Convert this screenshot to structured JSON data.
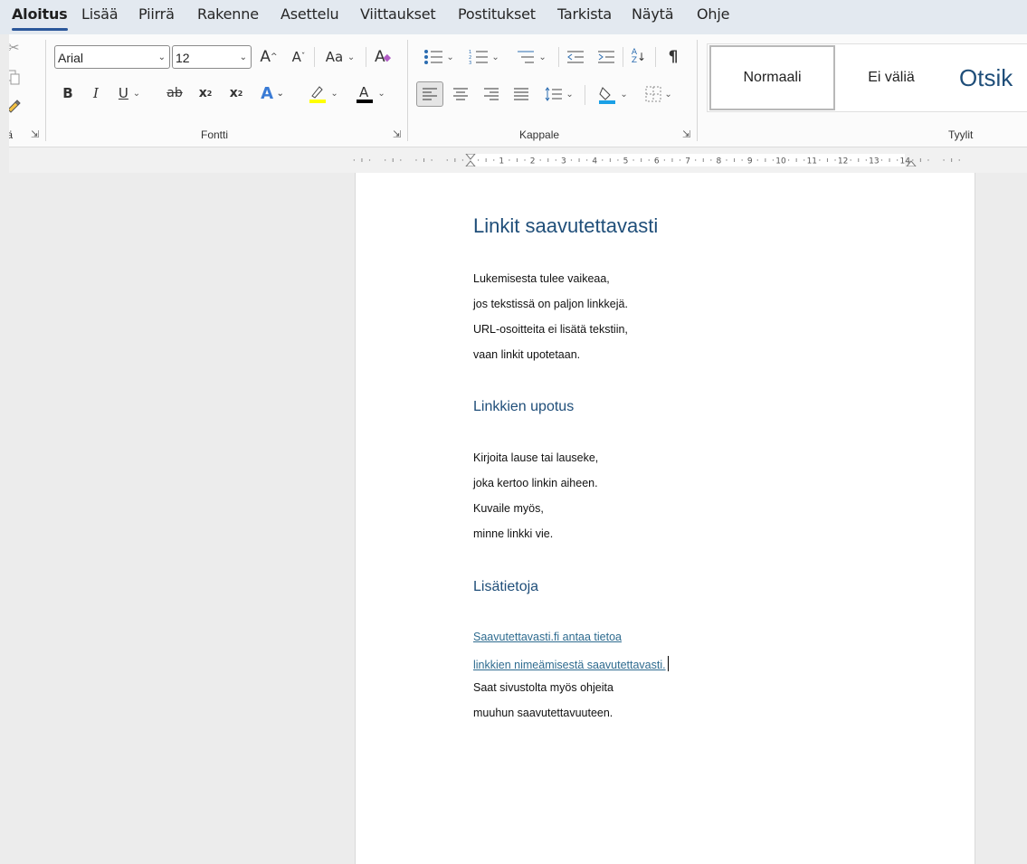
{
  "tabs": [
    "Aloitus",
    "Lisää",
    "Piirrä",
    "Rakenne",
    "Asettelu",
    "Viittaukset",
    "Postitukset",
    "Tarkista",
    "Näytä",
    "Ohje"
  ],
  "ribbon": {
    "clipboard_label_partial": "tä",
    "font_name": "Arial",
    "font_size": "12",
    "groups": {
      "font": "Fontti",
      "paragraph": "Kappale",
      "styles": "Tyylit"
    },
    "styles": [
      "Normaali",
      "Ei väliä",
      "Otsik"
    ],
    "change_case_label": "Aa",
    "icons": [
      "cut-icon",
      "copy-icon",
      "format-painter-icon",
      "grow-font-icon",
      "shrink-font-icon",
      "clear-formatting-icon",
      "bold-icon",
      "italic-icon",
      "underline-icon",
      "strikethrough-icon",
      "subscript-icon",
      "superscript-icon",
      "text-effects-icon",
      "highlight-icon",
      "font-color-icon",
      "bullets-icon",
      "numbering-icon",
      "multilevel-list-icon",
      "decrease-indent-icon",
      "increase-indent-icon",
      "sort-icon",
      "show-marks-icon",
      "align-left-icon",
      "center-icon",
      "align-right-icon",
      "justify-icon",
      "line-spacing-icon",
      "shading-icon",
      "borders-icon"
    ],
    "highlight_color": "#ffff00",
    "font_color": "#000000",
    "shading_color": "#1aa0e6"
  },
  "ruler": {
    "numbers": [
      "1",
      "2",
      "3",
      "4",
      "5",
      "6",
      "7",
      "8",
      "9",
      "10",
      "11",
      "12",
      "13",
      "14"
    ]
  },
  "document": {
    "title": "Linkit saavutettavasti",
    "para1": [
      "Lukemisesta tulee vaikeaa,",
      "jos tekstissä on paljon linkkejä.",
      "URL-osoitteita ei lisätä tekstiin,",
      "vaan linkit upotetaan."
    ],
    "heading2": "Linkkien upotus",
    "para2": [
      "Kirjoita lause tai lauseke,",
      "joka kertoo linkin aiheen.",
      "Kuvaile myös,",
      "minne linkki vie."
    ],
    "heading3": "Lisätietoja",
    "link1": "Saavutettavasti.fi antaa tietoa",
    "link2": "linkkien nimeämisestä saavutettavasti.",
    "para3": [
      "Saat sivustolta myös ohjeita",
      "muuhun saavutettavuuteen."
    ],
    "heading_color": "#1f4e79",
    "link_color": "#2e6b8f"
  }
}
